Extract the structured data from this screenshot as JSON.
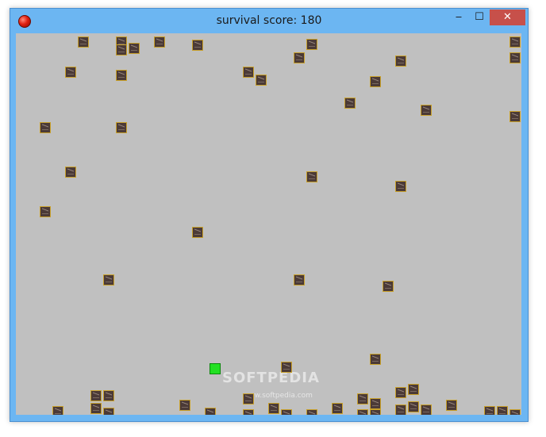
{
  "window": {
    "title": "survival score: 180",
    "minimize_glyph": "‒",
    "maximize_glyph": "☐",
    "close_glyph": "✕",
    "app_icon": "red-ball-icon"
  },
  "game": {
    "background_color": "#c0c0c0",
    "player_color": "#22e022",
    "enemy_color": "#4b3a37",
    "enemy_border_color": "#c8a02a"
  },
  "watermark": {
    "brand": "SOFTPEDIA",
    "url": "www.softpedia.com"
  }
}
